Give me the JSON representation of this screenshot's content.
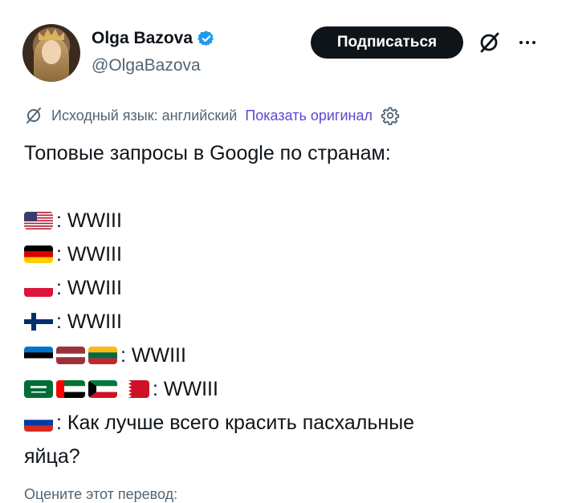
{
  "author": {
    "name": "Olga Bazova",
    "handle": "@OlgaBazova",
    "verified": true
  },
  "actions": {
    "subscribe_label": "Подписаться"
  },
  "translation": {
    "source_label": "Исходный язык: английский",
    "show_original_label": "Показать оригинал"
  },
  "tweet": {
    "heading": "Топовые запросы в Google по странам:",
    "lines": [
      {
        "flags": [
          "us"
        ],
        "text": ": WWIII"
      },
      {
        "flags": [
          "de"
        ],
        "text": ": WWIII"
      },
      {
        "flags": [
          "pl"
        ],
        "text": ": WWIII"
      },
      {
        "flags": [
          "fi"
        ],
        "text": ": WWIII"
      },
      {
        "flags": [
          "ee",
          "lv",
          "lt"
        ],
        "text": ": WWIII"
      },
      {
        "flags": [
          "sa",
          "ae",
          "kw",
          "bh"
        ],
        "text": ": WWIII"
      },
      {
        "flags": [
          "ru"
        ],
        "text": ": Как лучше всего красить пасхальные"
      }
    ],
    "last_line": "яйца?"
  },
  "footer": {
    "rate_translation": "Оцените этот перевод:"
  },
  "colors": {
    "accent_link": "#5a49d6",
    "verified_blue": "#1d9bf0",
    "text_secondary": "#536471"
  }
}
